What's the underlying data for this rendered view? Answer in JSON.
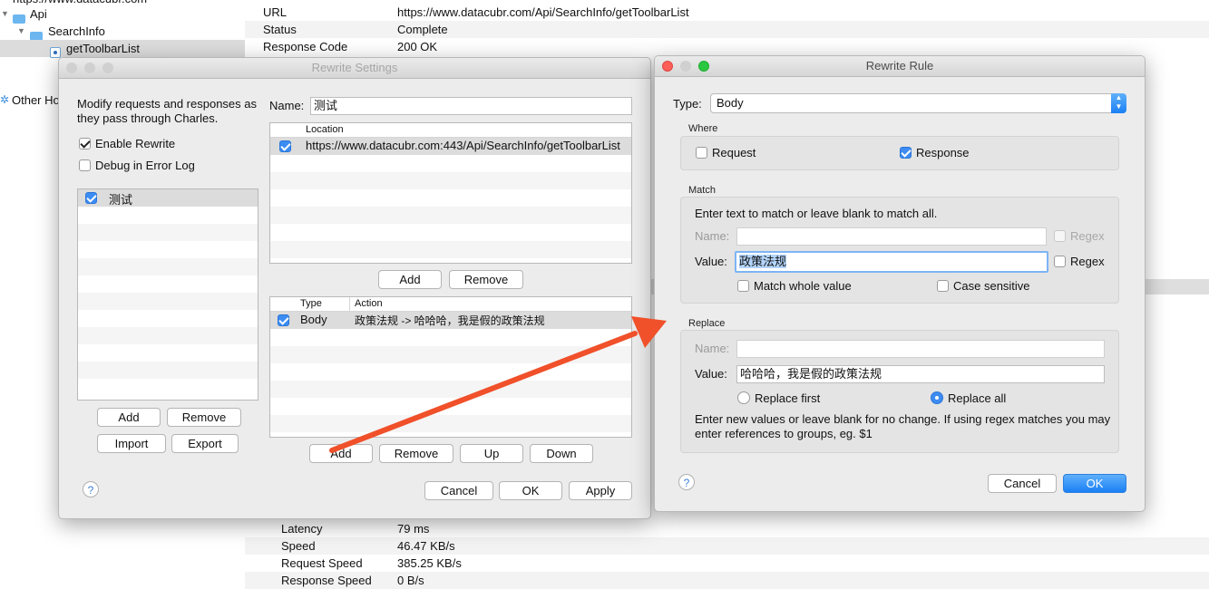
{
  "tree": {
    "host_partial": "https://www.datacubr.com",
    "api": "Api",
    "searchinfo": "SearchInfo",
    "selected_node": "getToolbarList",
    "other_hosts": "Other Ho"
  },
  "info": {
    "top_rows": [
      {
        "key": "URL",
        "value": "https://www.datacubr.com/Api/SearchInfo/getToolbarList"
      },
      {
        "key": "Status",
        "value": "Complete"
      },
      {
        "key": "Response Code",
        "value": "200 OK"
      }
    ],
    "bottom_rows": [
      {
        "key": "Latency",
        "value": "79 ms"
      },
      {
        "key": "Speed",
        "value": "46.47 KB/s"
      },
      {
        "key": "Request Speed",
        "value": "385.25 KB/s"
      },
      {
        "key": "Response Speed",
        "value": "0 B/s"
      }
    ]
  },
  "rewrite_settings": {
    "title": "Rewrite Settings",
    "description": "Modify requests and responses as they pass through Charles.",
    "enable_rewrite": "Enable Rewrite",
    "debug_log": "Debug in Error Log",
    "sets": [
      {
        "name": "测试",
        "checked": true
      }
    ],
    "name_label": "Name:",
    "name_value": "测试",
    "location_header": "Location",
    "locations": [
      {
        "url": "https://www.datacubr.com:443/Api/SearchInfo/getToolbarList",
        "checked": true
      }
    ],
    "rules_headers": {
      "type": "Type",
      "action": "Action"
    },
    "rules": [
      {
        "type": "Body",
        "action": "政策法规 -> 哈哈哈，我是假的政策法规",
        "checked": true
      }
    ],
    "buttons": {
      "sets_add": "Add",
      "sets_remove": "Remove",
      "import": "Import",
      "export": "Export",
      "loc_add": "Add",
      "loc_remove": "Remove",
      "rule_add": "Add",
      "rule_remove": "Remove",
      "rule_up": "Up",
      "rule_down": "Down",
      "cancel": "Cancel",
      "ok": "OK",
      "apply": "Apply"
    },
    "help": "?"
  },
  "rewrite_rule": {
    "title": "Rewrite Rule",
    "type_label": "Type:",
    "type_value": "Body",
    "where_label": "Where",
    "request": "Request",
    "response": "Response",
    "match_label": "Match",
    "match_hint": "Enter text to match or leave blank to match all.",
    "name_label": "Name:",
    "value_label": "Value:",
    "match_value": "政策法规",
    "regex": "Regex",
    "match_whole": "Match whole value",
    "case_sensitive": "Case sensitive",
    "replace_label": "Replace",
    "replace_value": "哈哈哈，我是假的政策法规",
    "replace_first": "Replace first",
    "replace_all": "Replace all",
    "replace_hint": "Enter new values or leave blank for no change. If using regex matches you may enter references to groups, eg. $1",
    "cancel": "Cancel",
    "ok": "OK",
    "help": "?"
  },
  "colors": {
    "accent": "#3c8cf2",
    "arrow": "#f0502a",
    "window_bg": "#ececec"
  }
}
